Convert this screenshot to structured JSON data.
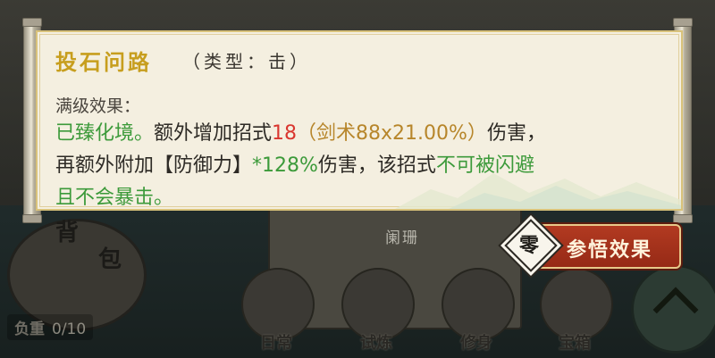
{
  "tooltip": {
    "skill_name": "投石问路",
    "skill_type": "（类型：击）",
    "level_label": "满级效果：",
    "line1": {
      "a": "已臻化境。",
      "b": "额外增加招式",
      "c": "18",
      "d": "（剑术88x21.00%）",
      "e": "伤害，"
    },
    "line2": {
      "a": "再额外附加【防御力】",
      "b": "*128%",
      "c": "伤害，该招式",
      "d": "不可被闪避"
    },
    "line3": {
      "a": "且不会暴击。"
    }
  },
  "insight_button": {
    "badge": "零",
    "label": "参悟效果"
  },
  "background": {
    "center_label": "阑珊",
    "bag_char1": "背",
    "bag_char2": "包",
    "weight_label": "负重",
    "weight_value": "0/10",
    "bottom_tabs": [
      "日常",
      "试炼",
      "修身",
      "宝箱"
    ]
  },
  "colors": {
    "skill_name": "#c79e1e",
    "highlight_green": "#3c9a3a",
    "highlight_red": "#d9362f",
    "highlight_brown": "#b7862b",
    "button_red": "#a8331b"
  }
}
